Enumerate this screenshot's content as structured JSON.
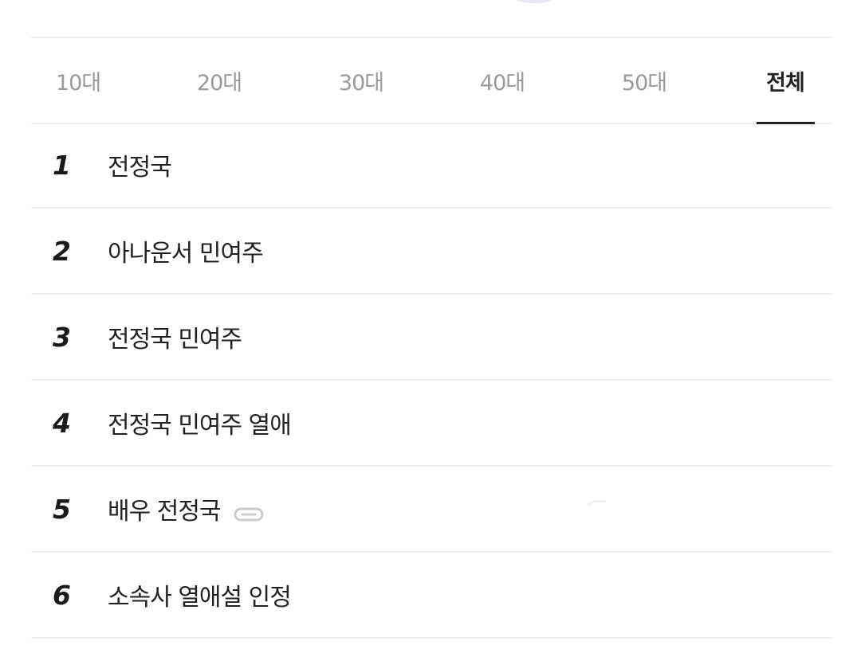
{
  "tabs": [
    {
      "label": "10대",
      "active": false
    },
    {
      "label": "20대",
      "active": false
    },
    {
      "label": "30대",
      "active": false
    },
    {
      "label": "40대",
      "active": false
    },
    {
      "label": "50대",
      "active": false
    },
    {
      "label": "전체",
      "active": true
    }
  ],
  "ranking": [
    {
      "rank": "1",
      "keyword": "전정국"
    },
    {
      "rank": "2",
      "keyword": "아나운서 민여주"
    },
    {
      "rank": "3",
      "keyword": "전정국 민여주"
    },
    {
      "rank": "4",
      "keyword": "전정국 민여주 열애"
    },
    {
      "rank": "5",
      "keyword": "배우 전정국",
      "icon": "link-icon"
    },
    {
      "rank": "6",
      "keyword": "소속사 열애설 인정"
    }
  ],
  "colors": {
    "active_tab": "#222222",
    "inactive_tab": "#9a9a9a",
    "divider": "#eeeeee"
  }
}
